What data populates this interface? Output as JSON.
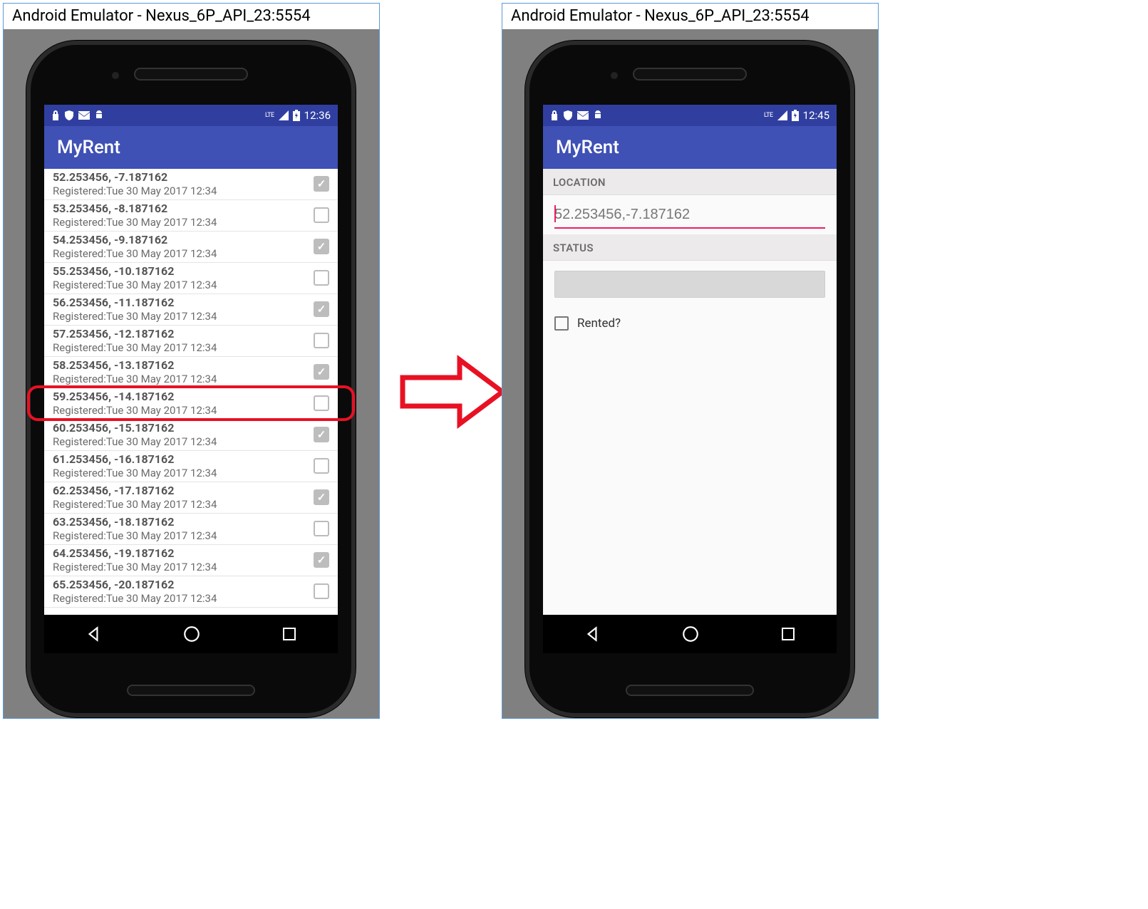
{
  "emulator": {
    "title": "Android Emulator - Nexus_6P_API_23:5554"
  },
  "left": {
    "time": "12:36",
    "lte": "LTE",
    "app_title": "MyRent",
    "highlight_index": 7,
    "rows": [
      {
        "coords": "52.253456, -7.187162",
        "sub": "Registered:Tue 30 May 2017 12:34",
        "checked": true
      },
      {
        "coords": "53.253456, -8.187162",
        "sub": "Registered:Tue 30 May 2017 12:34",
        "checked": false
      },
      {
        "coords": "54.253456, -9.187162",
        "sub": "Registered:Tue 30 May 2017 12:34",
        "checked": true
      },
      {
        "coords": "55.253456, -10.187162",
        "sub": "Registered:Tue 30 May 2017 12:34",
        "checked": false
      },
      {
        "coords": "56.253456, -11.187162",
        "sub": "Registered:Tue 30 May 2017 12:34",
        "checked": true
      },
      {
        "coords": "57.253456, -12.187162",
        "sub": "Registered:Tue 30 May 2017 12:34",
        "checked": false
      },
      {
        "coords": "58.253456, -13.187162",
        "sub": "Registered:Tue 30 May 2017 12:34",
        "checked": true
      },
      {
        "coords": "59.253456, -14.187162",
        "sub": "Registered:Tue 30 May 2017 12:34",
        "checked": false
      },
      {
        "coords": "60.253456, -15.187162",
        "sub": "Registered:Tue 30 May 2017 12:34",
        "checked": true
      },
      {
        "coords": "61.253456, -16.187162",
        "sub": "Registered:Tue 30 May 2017 12:34",
        "checked": false
      },
      {
        "coords": "62.253456, -17.187162",
        "sub": "Registered:Tue 30 May 2017 12:34",
        "checked": true
      },
      {
        "coords": "63.253456, -18.187162",
        "sub": "Registered:Tue 30 May 2017 12:34",
        "checked": false
      },
      {
        "coords": "64.253456, -19.187162",
        "sub": "Registered:Tue 30 May 2017 12:34",
        "checked": true
      },
      {
        "coords": "65.253456, -20.187162",
        "sub": "Registered:Tue 30 May 2017 12:34",
        "checked": false
      }
    ]
  },
  "right": {
    "time": "12:45",
    "lte": "LTE",
    "app_title": "MyRent",
    "section_location": "LOCATION",
    "location_value": "52.253456,-7.187162",
    "section_status": "STATUS",
    "rented_label": "Rented?",
    "rented_checked": false
  }
}
